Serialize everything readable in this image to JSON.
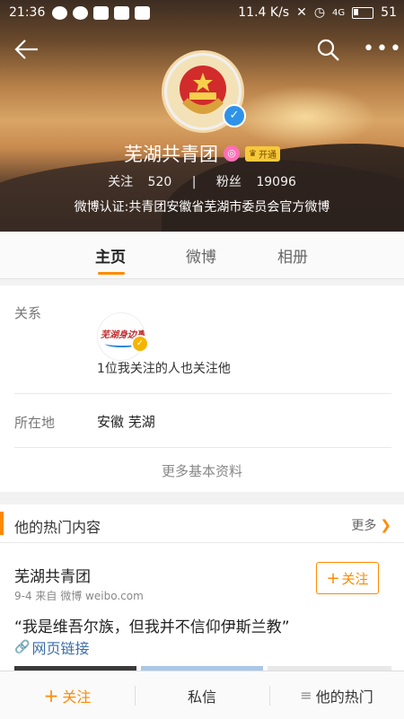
{
  "status_bar": {
    "time": "21:36",
    "speed": "11.4 K/s",
    "network": "4G",
    "battery": "51"
  },
  "profile": {
    "name": "芜湖共青团",
    "vip_label": "开通",
    "following_label": "关注",
    "following_count": "520",
    "followers_label": "粉丝",
    "followers_count": "19096",
    "separator": "|",
    "certification": "微博认证:共青团安徽省芜湖市委员会官方微博"
  },
  "tabs": [
    {
      "label": "主页",
      "active": true
    },
    {
      "label": "微博",
      "active": false
    },
    {
      "label": "相册",
      "active": false
    }
  ],
  "info": {
    "relation_label": "关系",
    "relation_avatar_text": "芜湖身边事",
    "relation_text": "1位我关注的人也关注他",
    "location_label": "所在地",
    "location_value": "安徽 芜湖",
    "more_basic": "更多基本资料"
  },
  "hot": {
    "title": "他的热门内容",
    "more": "更多",
    "post": {
      "author": "芜湖共青团",
      "meta": "9-4  来自 微博 weibo.com",
      "follow": "关注",
      "text": "“我是维吾尔族，但我并不信仰伊斯兰教”",
      "link": "网页链接"
    }
  },
  "bottom_bar": {
    "follow": "关注",
    "message": "私信",
    "hot": "他的热门"
  },
  "colors": {
    "accent": "#ff8a00",
    "verify_blue": "#2e93e8",
    "link": "#3b6ea8"
  }
}
